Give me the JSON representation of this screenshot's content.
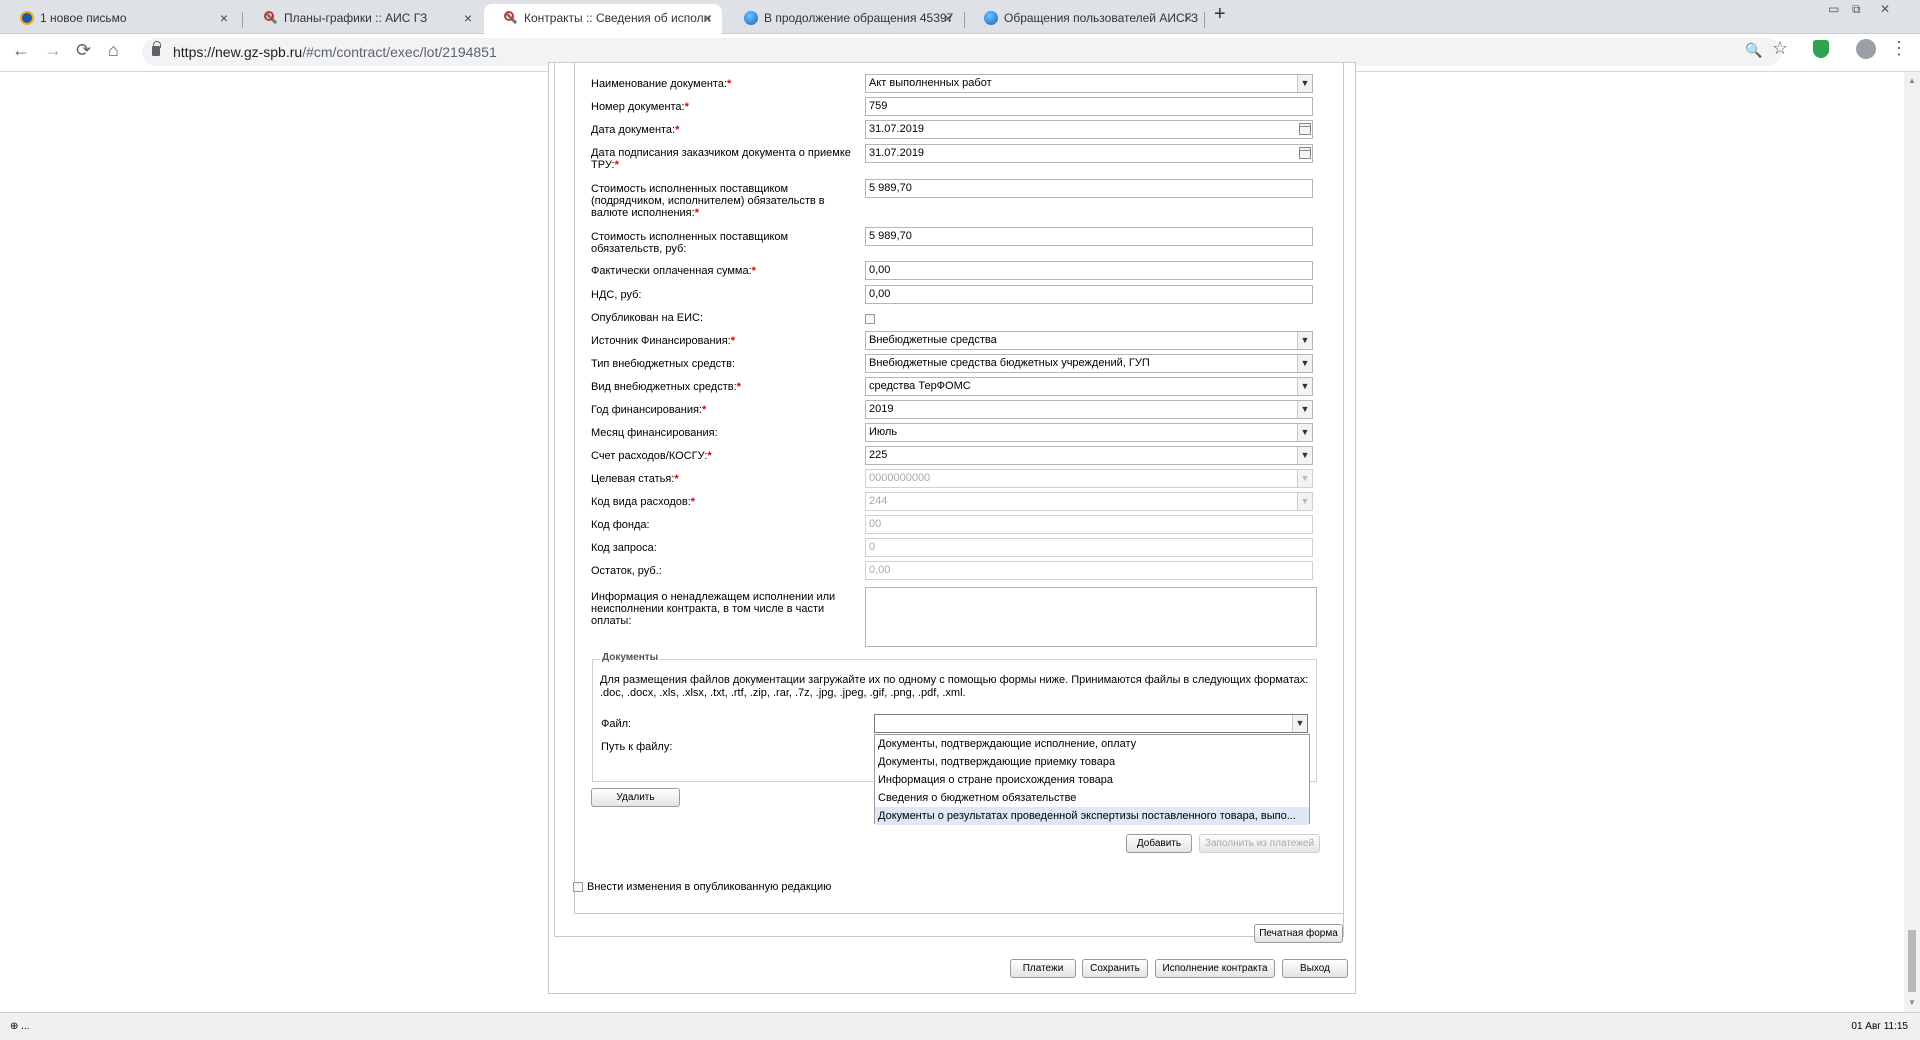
{
  "tabs": [
    {
      "title": "1 новое письмо",
      "icon": "mail-icon"
    },
    {
      "title": "Планы-графики :: АИС ГЗ",
      "icon": "tool-icon"
    },
    {
      "title": "Контракты :: Сведения об исполн",
      "icon": "tool-icon"
    },
    {
      "title": "В продолжение обращения 45397",
      "icon": "globe-icon"
    },
    {
      "title": "Обращения пользователей АИСГЗ",
      "icon": "globe-icon"
    }
  ],
  "browser": {
    "url_host": "https://new.gz-spb.ru",
    "url_path": "/#cm/contract/exec/lot/2194851",
    "new_tab": "+",
    "close": "×",
    "back": "←",
    "forward": "→",
    "reload": "⟳",
    "home": "⌂",
    "zoom": "🔍",
    "star": "☆",
    "menu": "⋮",
    "minimize": "▭",
    "restore": "⧉",
    "win_close": "✕"
  },
  "form": {
    "fields": [
      {
        "label": "Наименование документа:",
        "required": true,
        "value": "Акт выполненных работ",
        "type": "select"
      },
      {
        "label": "Номер документа:",
        "required": true,
        "value": "759",
        "type": "text"
      },
      {
        "label": "Дата документа:",
        "required": true,
        "value": "31.07.2019",
        "type": "date"
      },
      {
        "label": "Дата подписания заказчиком документа о приемке ТРУ:",
        "required": true,
        "value": "31.07.2019",
        "type": "date"
      },
      {
        "label": "Стоимость исполненных поставщиком (подрядчиком, исполнителем) обязательств в валюте исполнения:",
        "required": true,
        "value": "5 989,70",
        "type": "text"
      },
      {
        "label": "Стоимость исполненных поставщиком обязательств, руб:",
        "required": false,
        "value": "5 989,70",
        "type": "text"
      },
      {
        "label": "Фактически оплаченная сумма:",
        "required": true,
        "value": "0,00",
        "type": "text"
      },
      {
        "label": "НДС, руб:",
        "required": false,
        "value": "0,00",
        "type": "text"
      },
      {
        "label": "Опубликован на ЕИС:",
        "required": false,
        "value": "",
        "type": "checkbox"
      },
      {
        "label": "Источник Финансирования:",
        "required": true,
        "value": "Внебюджетные средства",
        "type": "select"
      },
      {
        "label": "Тип внебюджетных средств:",
        "required": false,
        "value": "Внебюджетные средства бюджетных учреждений, ГУП",
        "type": "select"
      },
      {
        "label": "Вид внебюджетных средств:",
        "required": true,
        "value": "средства ТерФОМС",
        "type": "select"
      },
      {
        "label": "Год финансирования:",
        "required": true,
        "value": "2019",
        "type": "select"
      },
      {
        "label": "Месяц финансирования:",
        "required": false,
        "value": "Июль",
        "type": "select"
      },
      {
        "label": "Счет расходов/КОСГУ:",
        "required": true,
        "value": "225",
        "type": "select"
      },
      {
        "label": "Целевая статья:",
        "required": true,
        "value": "0000000000",
        "type": "select-disabled"
      },
      {
        "label": "Код вида расходов:",
        "required": true,
        "value": "244",
        "type": "select-disabled"
      },
      {
        "label": "Код фонда:",
        "required": false,
        "value": "00",
        "type": "disabled"
      },
      {
        "label": "Код запроса:",
        "required": false,
        "value": "0",
        "type": "disabled"
      },
      {
        "label": "Остаток, руб.:",
        "required": false,
        "value": "0,00",
        "type": "disabled"
      }
    ],
    "info_label": "Информация о ненадлежащем исполнении или неисполнении контракта, в том числе в части оплаты:",
    "required_mark": "*"
  },
  "documents": {
    "legend": "Документы",
    "description": "Для размещения файлов документации загружайте их по одному с помощью формы ниже. Принимаются файлы в следующих форматах: .doc, .docx, .xls, .xlsx, .txt, .rtf, .zip, .rar, .7z, .jpg, .jpeg, .gif, .png, .pdf, .xml.",
    "file_label": "Файл:",
    "file_value": "",
    "path_label": "Путь к файлу:",
    "dropdown_options": [
      "Документы, подтверждающие исполнение, оплату",
      "Документы, подтверждающие приемку товара",
      "Информация о стране происхождения товара",
      "Сведения о бюджетном обязательстве",
      "Документы о результатах проведенной экспертизы поставленного товара, выпо..."
    ],
    "delete_button": "Удалить"
  },
  "actions": {
    "add": "Добавить",
    "fill_from_payments": "Заполнить из платежей",
    "publish_changes_label": "Внести изменения в опубликованную редакцию",
    "print_form": "Печатная форма",
    "payments": "Платежи",
    "save": "Сохранить",
    "contract_execution": "Исполнение контракта",
    "exit": "Выход"
  },
  "status": {
    "left": "⊕ ...",
    "right": "01 Авг 11:15"
  }
}
